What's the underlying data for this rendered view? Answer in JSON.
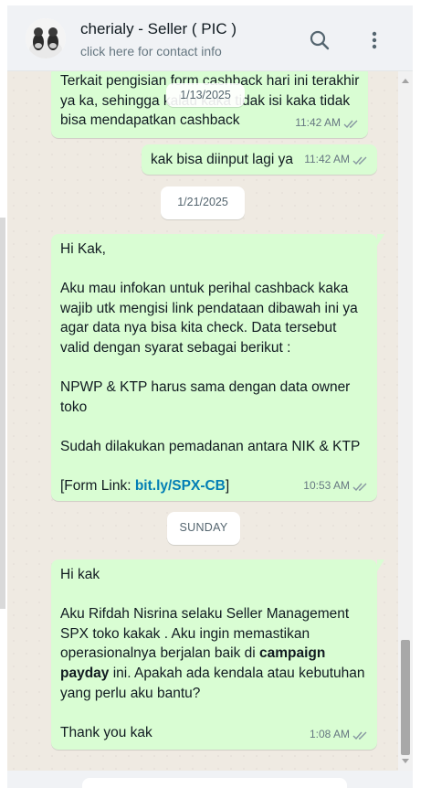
{
  "header": {
    "contact_name": "cherialy - Seller ( PIC )",
    "contact_subtitle": "click here for contact info"
  },
  "icons": {
    "search": "search-icon",
    "menu": "vertical-ellipsis-icon",
    "read_receipt": "double-check-icon"
  },
  "colors": {
    "outgoing_bubble": "#d9fdd3",
    "chat_background": "#efeae2",
    "header_background": "#f0f2f5",
    "link": "#027eb5"
  },
  "messages": [
    {
      "text": "Terkait pengisian form cashback hari ini terakhir ya ka, sehingga kalau kaka tidak isi kaka tidak bisa mendapatkan cashback",
      "time": "11:42 AM"
    },
    {
      "text": "kak bisa diinput lagi ya",
      "time": "11:42 AM"
    },
    {
      "lines": [
        "Hi Kak,",
        "",
        "Aku mau infokan untuk perihal cashback kaka wajib utk mengisi link pendataan dibawah ini ya agar data nya bisa kita check. Data tersebut valid dengan syarat sebagai berikut :",
        "",
        "NPWP & KTP harus sama dengan data owner toko",
        "",
        "Sudah dilakukan pemadanan antara NIK & KTP",
        ""
      ],
      "link_prefix": "[Form Link: ",
      "link_text": "bit.ly/SPX-CB",
      "link_suffix": "]",
      "time": "10:53 AM"
    },
    {
      "greeting": "Hi kak",
      "body_before": "Aku Rifdah Nisrina selaku Seller Management SPX toko kakak . Aku ingin memastikan operasionalnya berjalan baik di ",
      "body_bold": "campaign payday",
      "body_after": " ini. Apakah ada kendala atau kebutuhan yang perlu aku bantu?",
      "closing": "Thank you kak",
      "time": "1:08 AM"
    }
  ],
  "date_chips": {
    "floating": "1/13/2025",
    "chip1": "1/21/2025",
    "chip2": "SUNDAY"
  }
}
